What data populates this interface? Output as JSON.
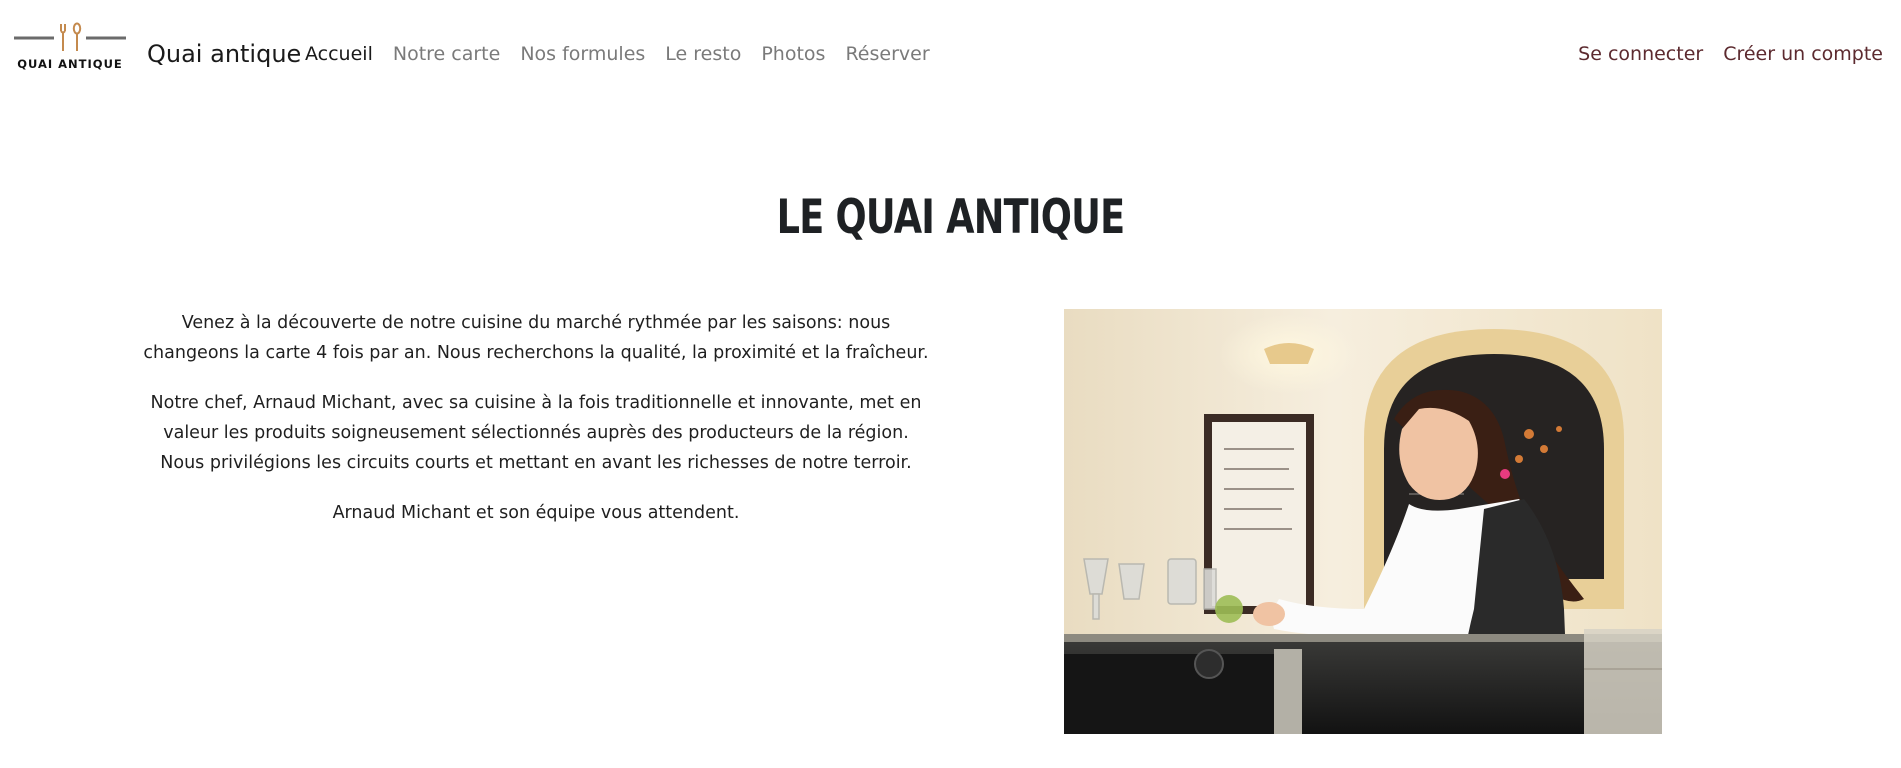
{
  "navbar": {
    "logo": {
      "text": "QUAI ANTIQUE",
      "icon": "fork-and-spoon-icon",
      "icon_color": "#c48a4e"
    },
    "brand": "Quai antique",
    "links": [
      {
        "label": "Accueil",
        "active": true
      },
      {
        "label": "Notre carte",
        "active": false
      },
      {
        "label": "Nos formules",
        "active": false
      },
      {
        "label": "Le resto",
        "active": false
      },
      {
        "label": "Photos",
        "active": false
      },
      {
        "label": "Réserver",
        "active": false
      }
    ],
    "auth": {
      "login": "Se connecter",
      "signup": "Créer un compte"
    }
  },
  "main": {
    "title": "LE QUAI ANTIQUE",
    "paragraphs": [
      "Venez à la découverte de notre cuisine du marché rythmée par les saisons: nous changeons la carte 4 fois par an. Nous recherchons la qualité, la proximité et la fraîcheur.",
      "Notre chef, Arnaud Michant, avec sa cuisine à la fois traditionnelle et innovante, met en valeur les produits soigneusement sélectionnés auprès des producteurs de la région. Nous privilégions les circuits courts et mettant en avant les richesses de notre terroir.",
      "Arnaud Michant et son équipe vous attendent."
    ]
  },
  "colors": {
    "nav_inactive": "#7a7a7a",
    "nav_active": "#1a1a1a",
    "auth_link": "#5c2a2f",
    "title": "#1e2124"
  }
}
